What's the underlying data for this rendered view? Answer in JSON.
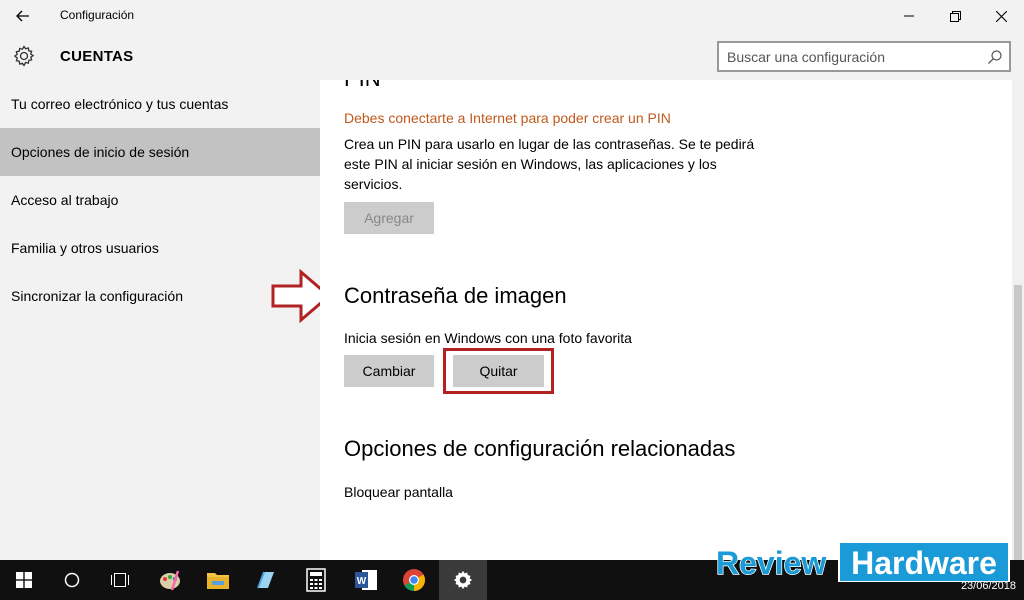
{
  "window": {
    "title": "Configuración",
    "back_icon": "arrow-left-icon",
    "controls": [
      "minimize-icon",
      "restore-icon",
      "close-icon"
    ]
  },
  "header": {
    "section_title": "CUENTAS",
    "icon": "gear-icon",
    "search_placeholder": "Buscar una configuración"
  },
  "sidebar": {
    "items": [
      {
        "label": "Tu correo electrónico y tus cuentas",
        "selected": false
      },
      {
        "label": "Opciones de inicio de sesión",
        "selected": true
      },
      {
        "label": "Acceso al trabajo",
        "selected": false
      },
      {
        "label": "Familia y otros usuarios",
        "selected": false
      },
      {
        "label": "Sincronizar la configuración",
        "selected": false
      }
    ]
  },
  "content": {
    "pin": {
      "heading_partial": "PIN",
      "warning": "Debes conectarte a Internet para poder crear un PIN",
      "description_lines": [
        "Crea un PIN para usarlo en lugar de las contraseñas. Se te pedirá",
        "este PIN al iniciar sesión en Windows, las aplicaciones y los",
        "servicios."
      ],
      "add_button": "Agregar"
    },
    "picture_password": {
      "heading": "Contraseña de imagen",
      "description": "Inicia sesión en Windows con una foto favorita",
      "change_button": "Cambiar",
      "remove_button": "Quitar"
    },
    "related": {
      "heading": "Opciones de configuración relacionadas",
      "link": "Bloquear pantalla"
    }
  },
  "annotation": {
    "arrow_color": "#b22222",
    "highlight_color": "#b22222"
  },
  "colors": {
    "warning": "#c05a1e",
    "selected_bg": "#c2c2c2"
  },
  "taskbar": {
    "icons": [
      "windows-start-icon",
      "cortana-circle-icon",
      "task-view-icon",
      "paint-icon",
      "file-explorer-icon",
      "notepad-icon",
      "calculator-icon",
      "word-icon",
      "chrome-icon",
      "settings-gear-icon"
    ],
    "active_index": 9,
    "date": "23/06/2018"
  },
  "watermark": {
    "part1": "Review",
    "part2": "Hardware"
  }
}
